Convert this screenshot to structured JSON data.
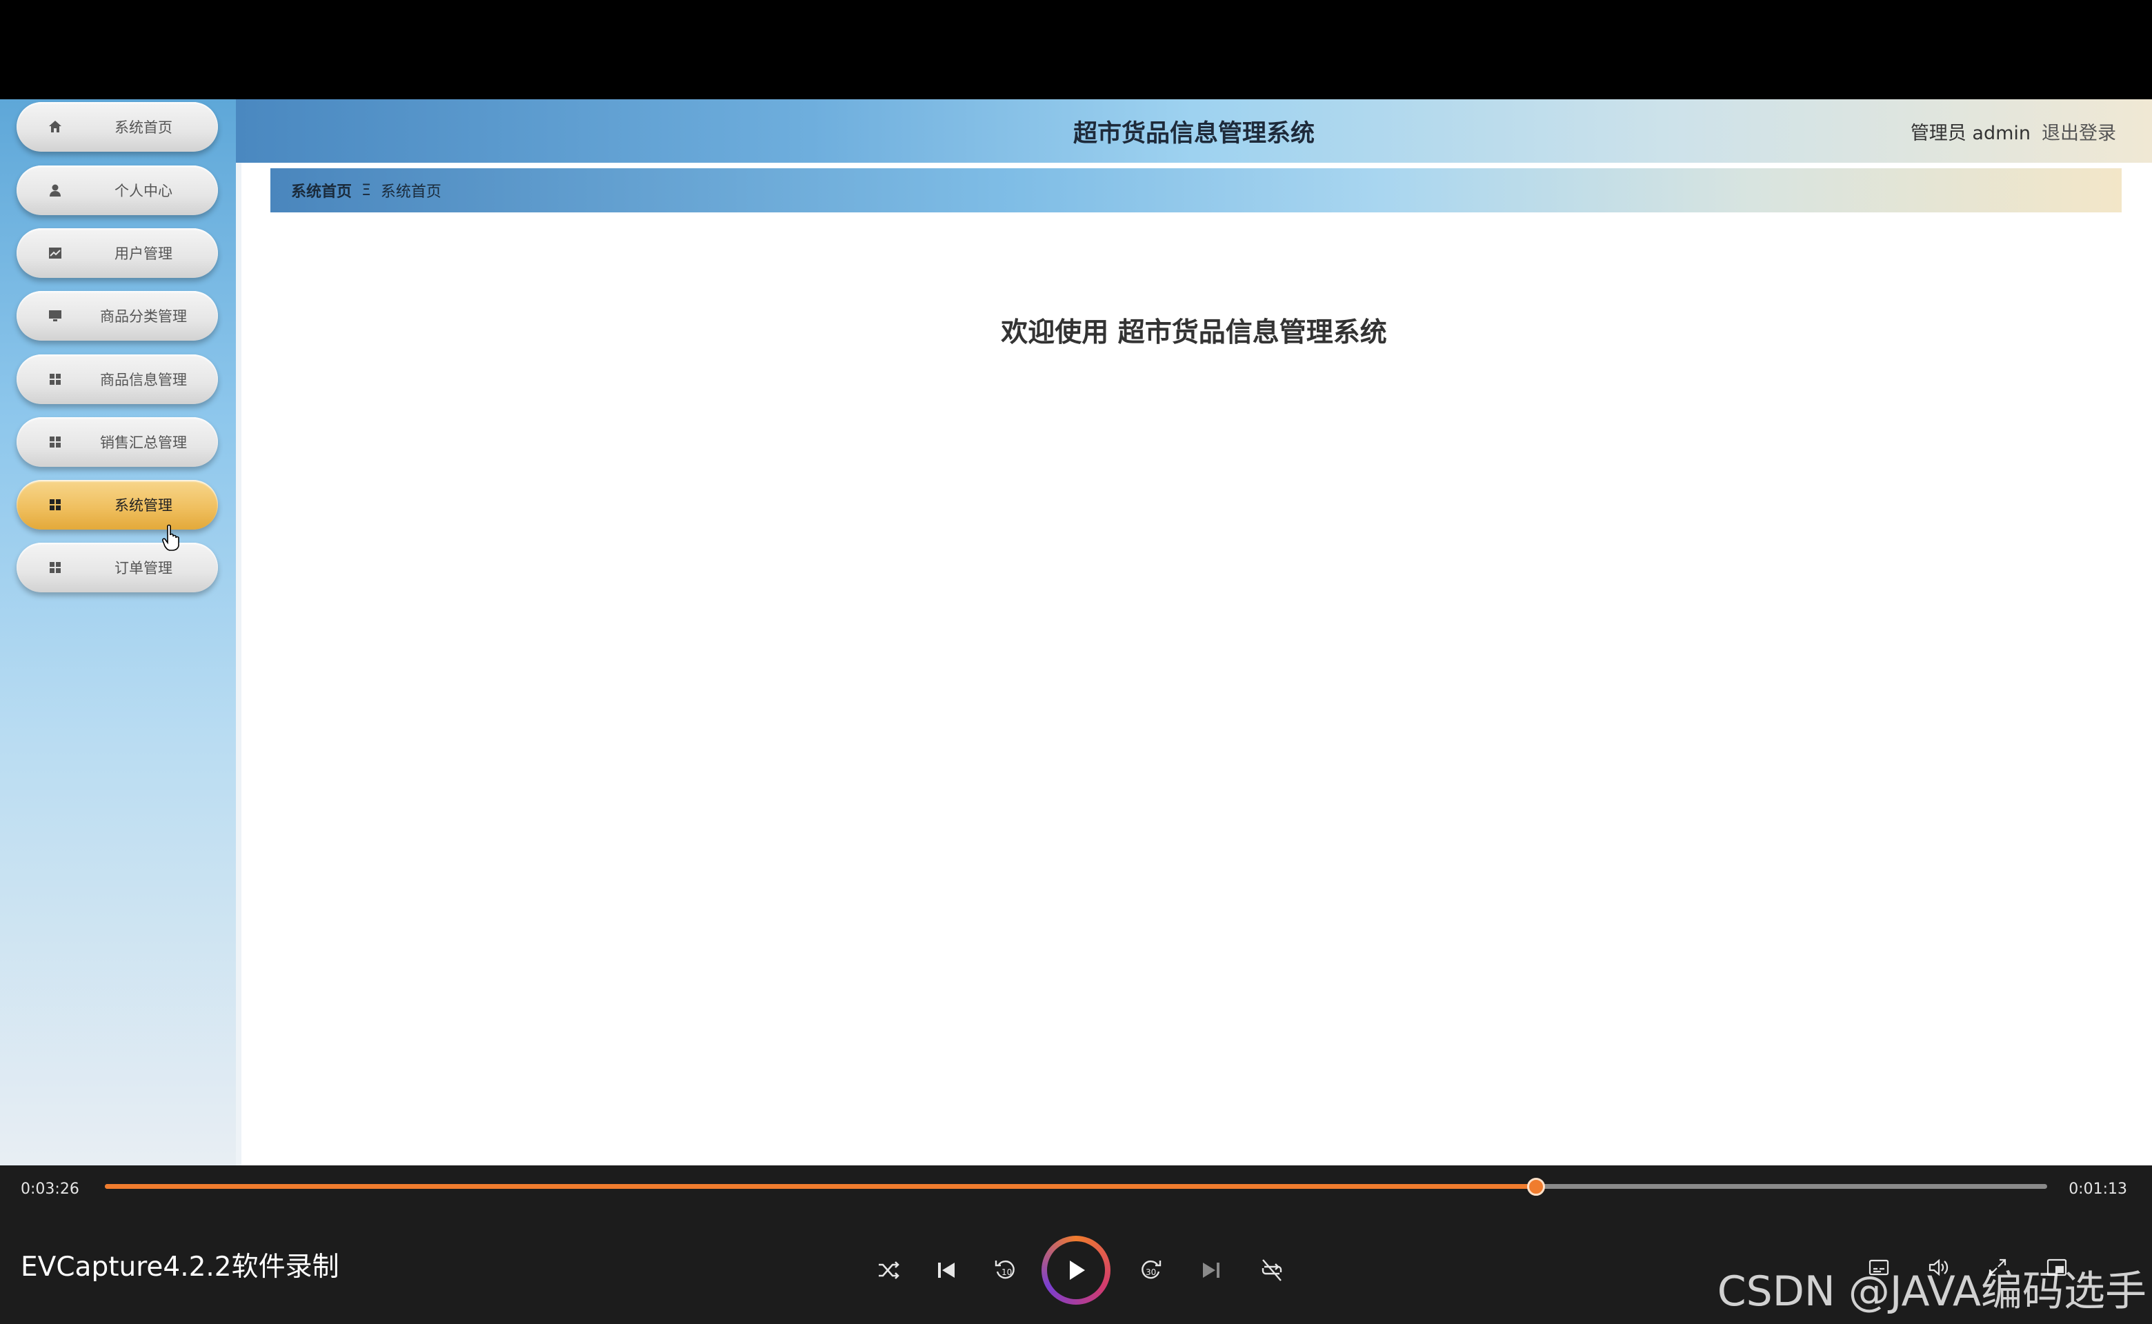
{
  "app": {
    "title": "超市货品信息管理系统",
    "user_label": "管理员 admin",
    "logout_label": "退出登录"
  },
  "sidebar": {
    "items": [
      {
        "label": "系统首页",
        "icon": "home-icon"
      },
      {
        "label": "个人中心",
        "icon": "user-icon"
      },
      {
        "label": "用户管理",
        "icon": "chart-icon"
      },
      {
        "label": "商品分类管理",
        "icon": "monitor-icon"
      },
      {
        "label": "商品信息管理",
        "icon": "grid-icon"
      },
      {
        "label": "销售汇总管理",
        "icon": "grid-icon"
      },
      {
        "label": "系统管理",
        "icon": "grid-icon",
        "active": true
      },
      {
        "label": "订单管理",
        "icon": "grid-icon"
      }
    ]
  },
  "breadcrumb": {
    "home": "系统首页",
    "separator": "Ξ",
    "current": "系统首页"
  },
  "main": {
    "welcome": "欢迎使用 超市货品信息管理系统"
  },
  "player": {
    "elapsed": "0:03:26",
    "remaining": "0:01:13",
    "progress": 0.737,
    "brand": "EVCapture4.2.2软件录制",
    "accent_color": "#f07c2e"
  },
  "watermark": "CSDN @JAVA编码选手"
}
